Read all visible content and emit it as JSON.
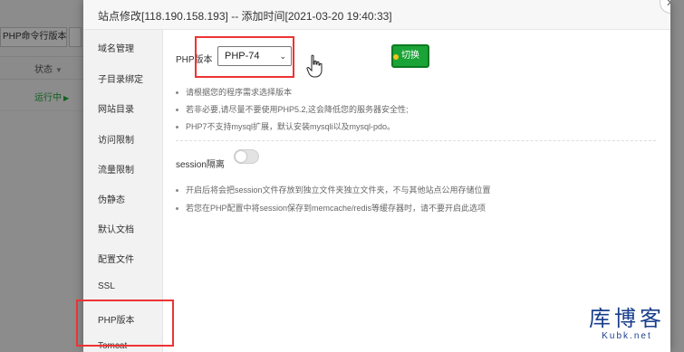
{
  "background": {
    "toolbar_button": "PHP命令行版本",
    "status_header": "状态",
    "status_running": "运行中"
  },
  "modal": {
    "title": "站点修改[118.190.158.193] -- 添加时间[2021-03-20 19:40:33]",
    "close_icon": "close-icon"
  },
  "sidebar": {
    "items": [
      {
        "label": "域名管理"
      },
      {
        "label": "子目录绑定"
      },
      {
        "label": "网站目录"
      },
      {
        "label": "访问限制"
      },
      {
        "label": "流量限制"
      },
      {
        "label": "伪静态"
      },
      {
        "label": "默认文档"
      },
      {
        "label": "配置文件"
      },
      {
        "label": "SSL"
      },
      {
        "label": "PHP版本"
      },
      {
        "label": "Tomcat"
      }
    ],
    "selected": "PHP版本"
  },
  "php": {
    "label": "PHP版本",
    "selected_version": "PHP-74",
    "switch_label": "切换",
    "hints": [
      "请根据您的程序需求选择版本",
      "若非必要,请尽量不要使用PHP5.2,这会降低您的服务器安全性;",
      "PHP7不支持mysql扩展，默认安装mysqli以及mysql-pdo。"
    ]
  },
  "session": {
    "label": "session隔离",
    "enabled": false,
    "hints": [
      "开启后将会把session文件存放到独立文件夹独立文件夹，不与其他站点公用存储位置",
      "若您在PHP配置中将session保存到memcache/redis等缓存器时，请不要开启此选项"
    ]
  },
  "watermark": {
    "text": "库博客",
    "url": "Kubk.net"
  },
  "colors": {
    "accent": "#20a53a",
    "highlight": "#ee3333",
    "watermark": "#1a3e8c"
  }
}
